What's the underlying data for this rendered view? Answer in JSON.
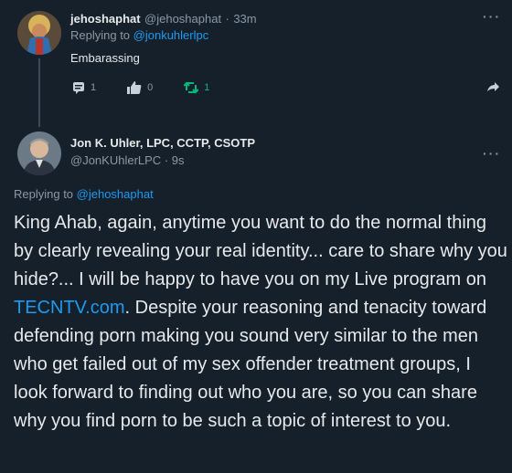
{
  "reply_tweet": {
    "display_name": "jehoshaphat",
    "handle": "@jehoshaphat",
    "separator": "·",
    "time": "33m",
    "replying_prefix": "Replying to ",
    "replying_to": "@jonkuhlerlpc",
    "text": "Embarassing",
    "reply_count": "1",
    "like_count": "0",
    "retweet_count": "1"
  },
  "main_tweet": {
    "display_name": "Jon K. Uhler, LPC, CCTP, CSOTP",
    "handle": "@JonKUhlerLPC",
    "separator": "·",
    "time": "9s",
    "replying_prefix": "Replying to ",
    "replying_to": "@jehoshaphat",
    "text_part1": "King Ahab, again, anytime you want to do the normal thing by clearly revealing your real identity... care to share why you hide?... I will be happy to have you on my Live program on ",
    "link_text": "TECNTV.com",
    "text_part2": ".  Despite your reasoning and tenacity toward defending porn making you sound very similar to the men who get failed out of my sex offender treatment groups, I look forward to finding out who you are, so you can share why you find porn to be such a topic of interest to you."
  },
  "more_label": "···",
  "colors": {
    "background": "#15202b",
    "link": "#1d9bf0",
    "retweet": "#00ba7c",
    "muted": "#8b98a5"
  },
  "icons": [
    "comment-icon",
    "like-icon",
    "retweet-icon",
    "share-icon",
    "more-icon"
  ]
}
